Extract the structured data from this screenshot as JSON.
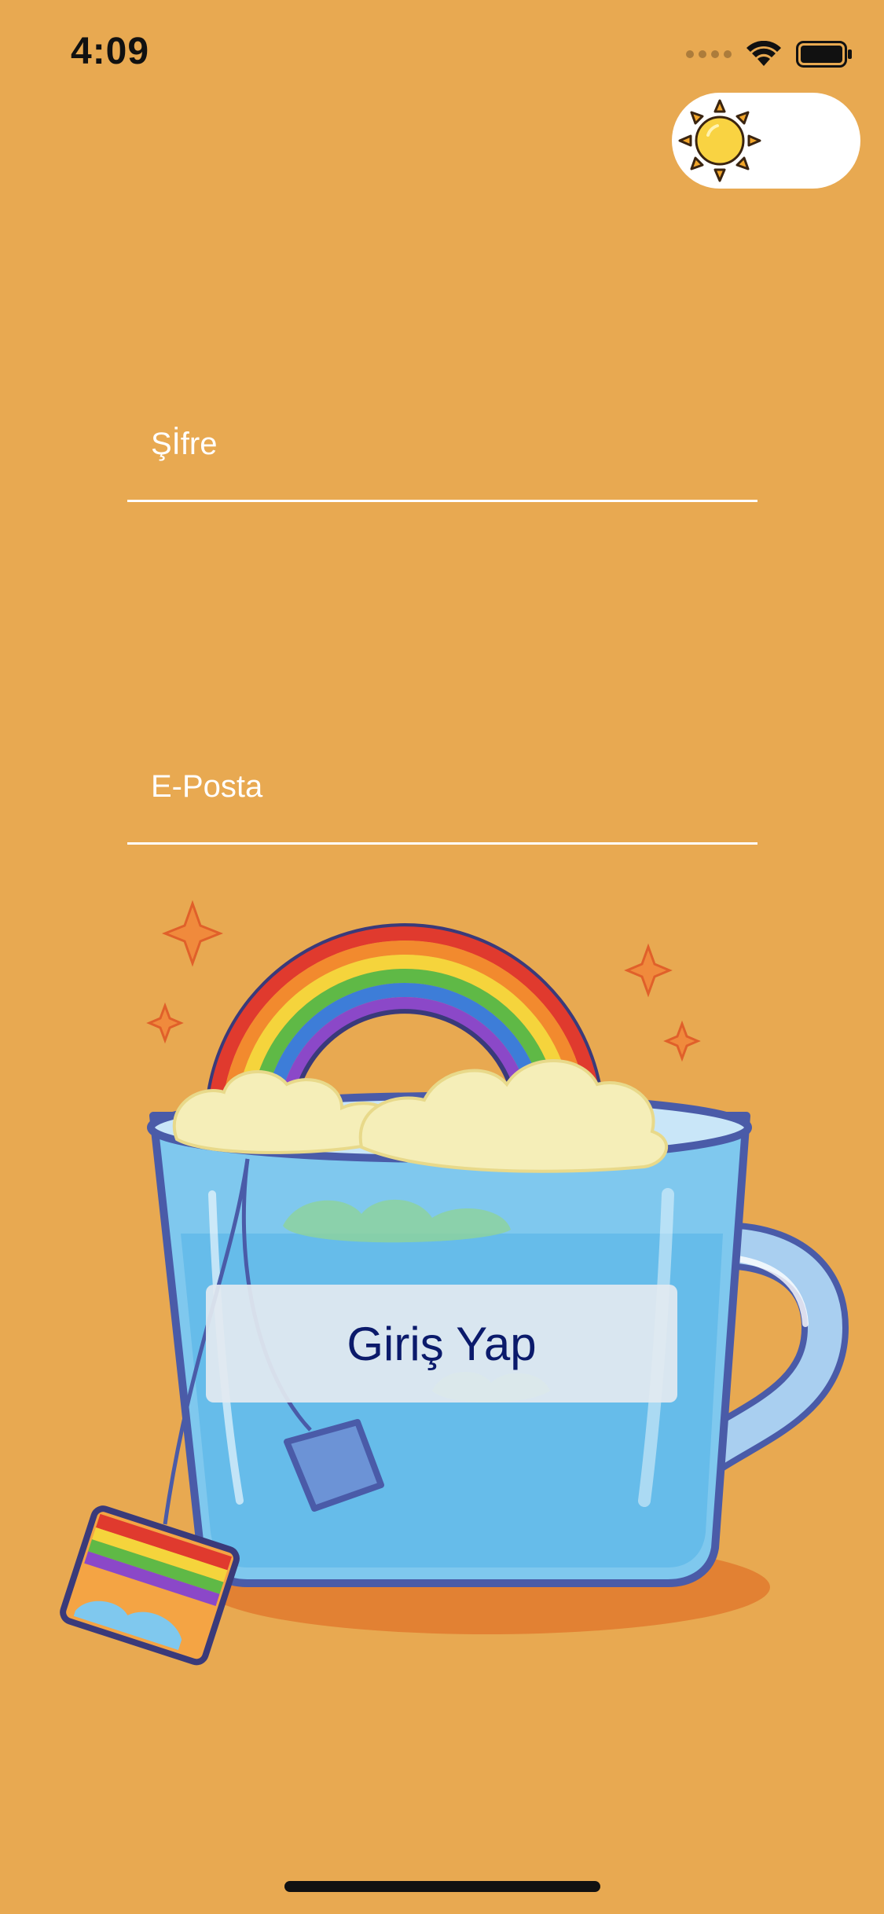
{
  "status_bar": {
    "time": "4:09"
  },
  "theme_toggle": {
    "icon": "sun-icon",
    "state": "light"
  },
  "form": {
    "password_placeholder": "Şİfre",
    "email_placeholder": "E-Posta",
    "login_label": "Giriş Yap"
  },
  "illustration": {
    "name": "rainbow-tea-cup-illustration"
  },
  "colors": {
    "background": "#E8A951",
    "field_line": "#FFFFFF",
    "button_bg": "#E2EAF0",
    "button_text": "#0B1A6B",
    "toggle_bg": "#FFFFFF",
    "sun": "#F9D342"
  }
}
